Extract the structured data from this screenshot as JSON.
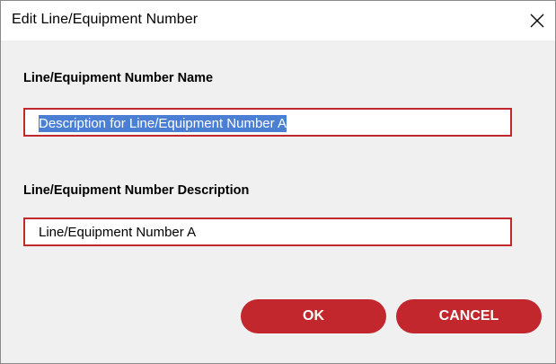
{
  "window": {
    "title": "Edit Line/Equipment Number",
    "close_icon": "close-icon"
  },
  "form": {
    "name_label": "Line/Equipment Number Name",
    "name_value": "Description for Line/Equipment Number A",
    "description_label": "Line/Equipment Number Description",
    "description_value": "Line/Equipment Number A"
  },
  "buttons": {
    "ok_label": "OK",
    "cancel_label": "CANCEL"
  },
  "colors": {
    "accent": "#c1272d",
    "selection": "#4a7fd4",
    "body_bg": "#f0f0f0"
  }
}
